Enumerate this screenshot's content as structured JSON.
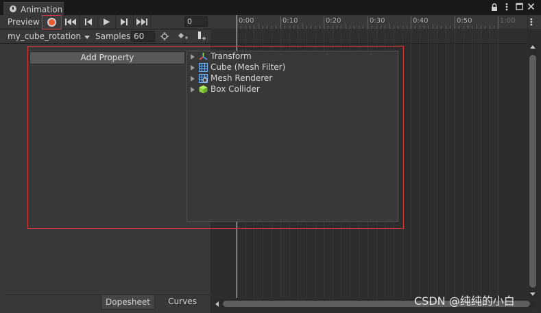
{
  "window": {
    "tab_title": "Animation",
    "tab_icon": "clock-icon"
  },
  "toolbar": {
    "preview_label": "Preview",
    "frame_value": "0",
    "clip_name": "my_cube_rotation",
    "samples_label": "Samples",
    "samples_value": "60"
  },
  "timeline": {
    "ticks": [
      "0:00",
      "0:10",
      "0:20",
      "0:30",
      "0:40",
      "0:50",
      "1:00"
    ]
  },
  "add_property": {
    "button_label": "Add Property",
    "items": [
      {
        "label": "Transform",
        "icon": "transform-icon"
      },
      {
        "label": "Cube (Mesh Filter)",
        "icon": "mesh-filter-icon"
      },
      {
        "label": "Mesh Renderer",
        "icon": "mesh-renderer-icon"
      },
      {
        "label": "Box Collider",
        "icon": "box-collider-icon"
      }
    ]
  },
  "bottom_tabs": {
    "dopesheet": "Dopesheet",
    "curves": "Curves"
  },
  "watermark": "CSDN @纯纯的小白",
  "colors": {
    "accent_red": "#d83a3a",
    "record": "#e85a32"
  }
}
